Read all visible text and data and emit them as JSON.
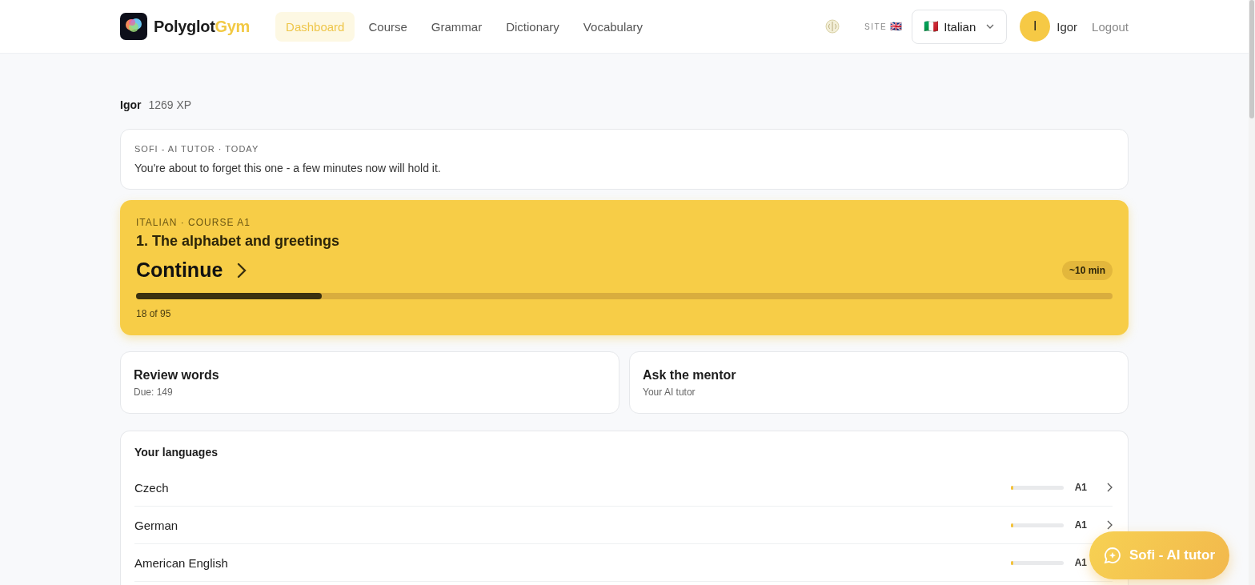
{
  "brand": {
    "name": "Polyglot",
    "accent": "Gym"
  },
  "nav": [
    {
      "label": "Dashboard",
      "selected": true
    },
    {
      "label": "Course",
      "selected": false
    },
    {
      "label": "Grammar",
      "selected": false
    },
    {
      "label": "Dictionary",
      "selected": false
    },
    {
      "label": "Vocabulary",
      "selected": false
    }
  ],
  "site_label": "SITE",
  "site_flag": "🇬🇧",
  "language_select": {
    "flag": "🇮🇹",
    "value": "Italian"
  },
  "user": {
    "initial": "I",
    "name": "Igor"
  },
  "logout": "Logout",
  "profile": {
    "name": "Igor",
    "xp": "1269 XP"
  },
  "tutor_note": {
    "heading": "SOFI - AI TUTOR · TODAY",
    "text": "You're about to forget this one - a few minutes now will hold it."
  },
  "course": {
    "eyebrow": "ITALIAN · COURSE A1",
    "lesson": "1. The alphabet and greetings",
    "action": "Continue",
    "duration": "~10 min",
    "level": 0.19,
    "progress": "18 of 95"
  },
  "cards": [
    {
      "title": "Review words",
      "subtitle": "Due: 149"
    },
    {
      "title": "Ask the mentor",
      "subtitle": "Your AI tutor"
    }
  ],
  "languages": {
    "title": "Your languages",
    "items": [
      {
        "name": "Czech",
        "level": 0.05,
        "grade": "A1"
      },
      {
        "name": "German",
        "level": 0.05,
        "grade": "A1"
      },
      {
        "name": "American English",
        "level": 0.05,
        "grade": "A1"
      }
    ]
  },
  "chat_button": "Sofi - AI tutor"
}
